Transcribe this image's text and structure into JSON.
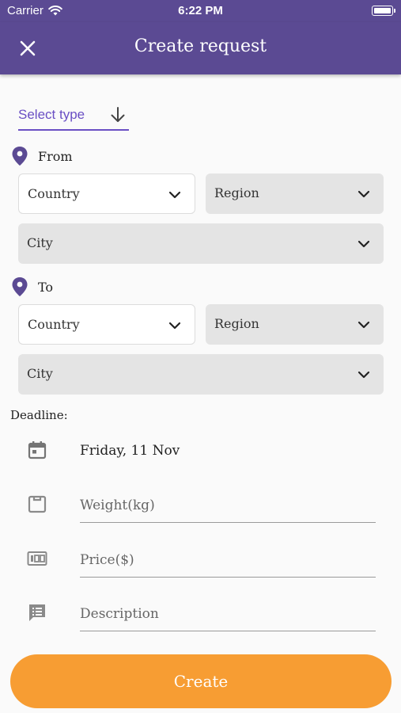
{
  "status_bar": {
    "carrier": "Carrier",
    "time": "6:22 PM"
  },
  "app_bar": {
    "title": "Create request"
  },
  "type_selector": {
    "label": "Select type"
  },
  "from": {
    "label": "From",
    "country": "Country",
    "region": "Region",
    "city": "City"
  },
  "to": {
    "label": "To",
    "country": "Country",
    "region": "Region",
    "city": "City"
  },
  "deadline": {
    "label": "Deadline:",
    "date": "Friday, 11 Nov"
  },
  "fields": {
    "weight_placeholder": "Weight(kg)",
    "price_placeholder": "Price($)",
    "description_placeholder": "Description"
  },
  "actions": {
    "create_label": "Create"
  },
  "colors": {
    "primary": "#5b4a93",
    "accent": "#6a4fc4",
    "button": "#f79d33"
  },
  "icons": [
    "close-icon",
    "arrow-down-icon",
    "location-pin-icon",
    "chevron-down-icon",
    "calendar-icon",
    "weight-icon",
    "price-icon",
    "description-icon",
    "wifi-icon",
    "battery-icon"
  ]
}
